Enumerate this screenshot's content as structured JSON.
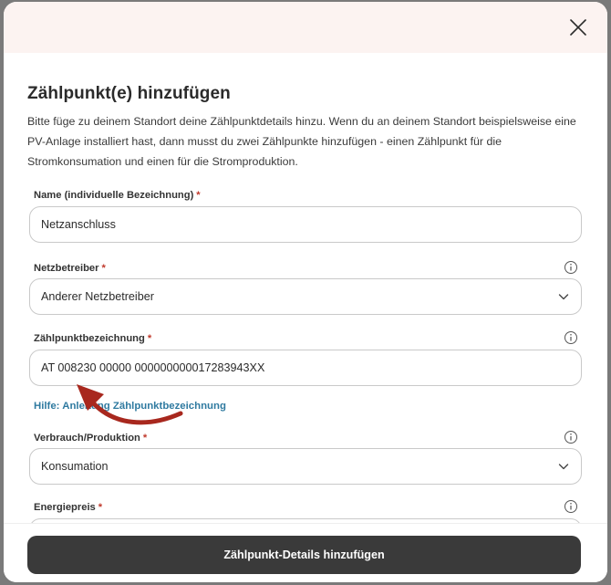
{
  "modal": {
    "title": "Zählpunkt(e) hinzufügen",
    "intro": "Bitte füge zu deinem Standort deine Zählpunktdetails hinzu. Wenn du an deinem Standort beispielsweise eine PV-Anlage installiert hast, dann musst du zwei Zählpunkte hinzufügen - einen Zählpunkt für die Stromkonsumation und einen für die Stromproduktion.",
    "close_icon": "close-icon"
  },
  "fields": {
    "name": {
      "label": "Name (individuelle Bezeichnung)",
      "required": "*",
      "value": "Netzanschluss"
    },
    "netzbetreiber": {
      "label": "Netzbetreiber",
      "required": "*",
      "value": "Anderer Netzbetreiber"
    },
    "zaehlpunkt": {
      "label": "Zählpunktbezeichnung",
      "required": "*",
      "value": "AT 008230 00000 000000000017283943XX"
    },
    "verbrauch": {
      "label": "Verbrauch/Produktion",
      "required": "*",
      "value": "Konsumation"
    },
    "energiepreis": {
      "label": "Energiepreis",
      "required": "*"
    }
  },
  "help": {
    "link": "Hilfe: Anleitung Zählpunktbezeichnung"
  },
  "footer": {
    "submit_label": "Zählpunkt-Details hinzufügen"
  },
  "colors": {
    "header_bg": "#fcf3f1",
    "required": "#c0392b",
    "link": "#2f7aa0",
    "button_bg": "#3a3a3a",
    "annotation_arrow": "#a8281e"
  }
}
